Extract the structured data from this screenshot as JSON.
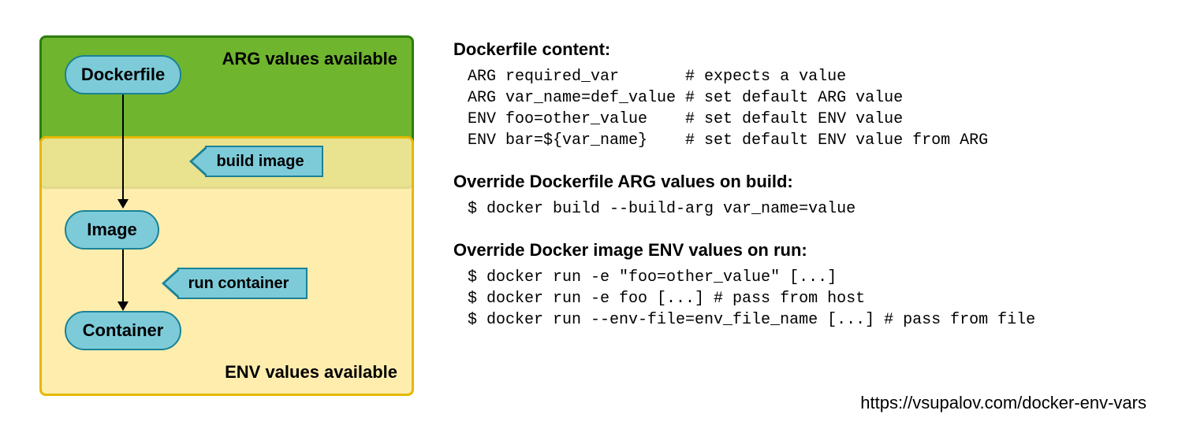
{
  "diagram": {
    "arg_label": "ARG values available",
    "env_label": "ENV values available",
    "nodes": {
      "dockerfile": "Dockerfile",
      "image": "Image",
      "container": "Container"
    },
    "tags": {
      "build": "build image",
      "run": "run container"
    }
  },
  "sections": {
    "dockerfile_content": {
      "title": "Dockerfile content:",
      "code": "ARG required_var       # expects a value\nARG var_name=def_value # set default ARG value\nENV foo=other_value    # set default ENV value\nENV bar=${var_name}    # set default ENV value from ARG"
    },
    "override_arg": {
      "title": "Override Dockerfile ARG values on build:",
      "code": "$ docker build --build-arg var_name=value"
    },
    "override_env": {
      "title": "Override Docker image ENV values on run:",
      "code": "$ docker run -e \"foo=other_value\" [...]\n$ docker run -e foo [...] # pass from host\n$ docker run --env-file=env_file_name [...] # pass from file"
    }
  },
  "source_url": "https://vsupalov.com/docker-env-vars"
}
